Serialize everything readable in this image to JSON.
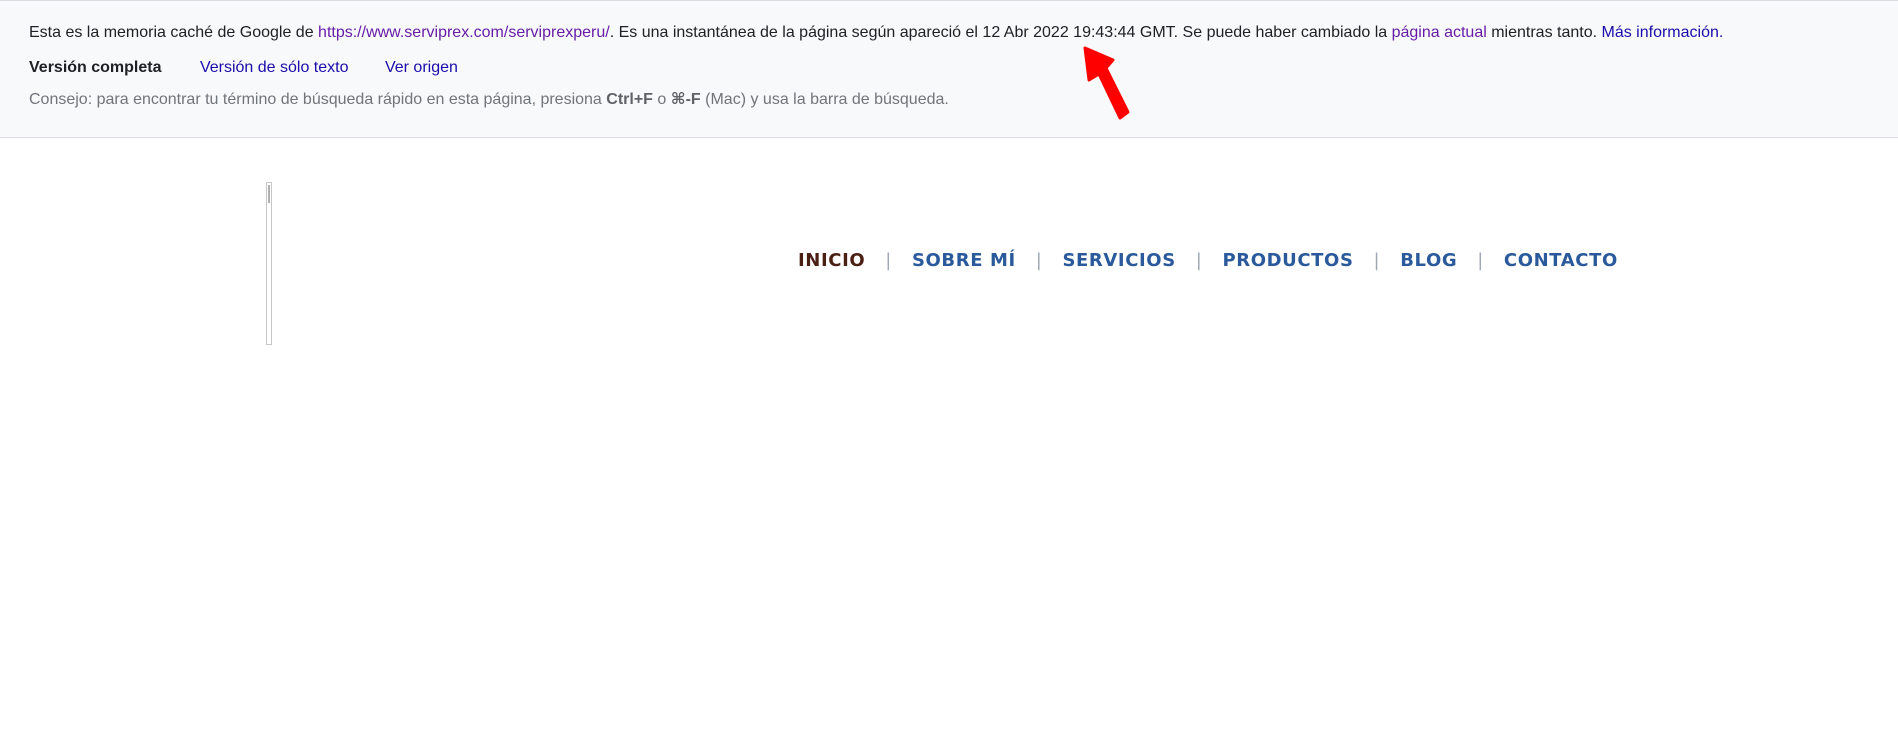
{
  "cache_banner": {
    "intro_text": "Esta es la memoria caché de Google de ",
    "cached_url": "https://www.serviprex.com/serviprexperu/",
    "snapshot_text": ". Es una instantánea de la página según apareció el 12 Abr 2022 19:43:44 GMT. Se puede haber cambiado la ",
    "current_page_link": "página actual",
    "meanwhile_text": " mientras tanto. ",
    "more_info_link": "Más información.",
    "versions": {
      "full": "Versión completa",
      "text_only": "Versión de sólo texto",
      "view_source": "Ver origen"
    },
    "tip": {
      "prefix": "Consejo: para encontrar tu término de búsqueda rápido en esta página, presiona ",
      "shortcut_ctrl": "Ctrl+F",
      "or_text": " o ",
      "shortcut_mac": "⌘-F",
      "suffix": " (Mac) y usa la barra de búsqueda."
    }
  },
  "annotation": {
    "arrow_color": "#ff0000",
    "arrow_icon": "red-pointer-arrow"
  },
  "site_nav": {
    "items": [
      {
        "label": "INICIO",
        "active": true
      },
      {
        "label": "SOBRE MÍ",
        "active": false
      },
      {
        "label": "SERVICIOS",
        "active": false
      },
      {
        "label": "PRODUCTOS",
        "active": false
      },
      {
        "label": "BLOG",
        "active": false
      },
      {
        "label": "CONTACTO",
        "active": false
      }
    ],
    "separator": "|"
  },
  "colors": {
    "banner_bg": "#f8f9fa",
    "link_visited": "#681da8",
    "link": "#1a0dab",
    "nav_link": "#2a5a9c",
    "nav_active": "#4a1f14"
  }
}
